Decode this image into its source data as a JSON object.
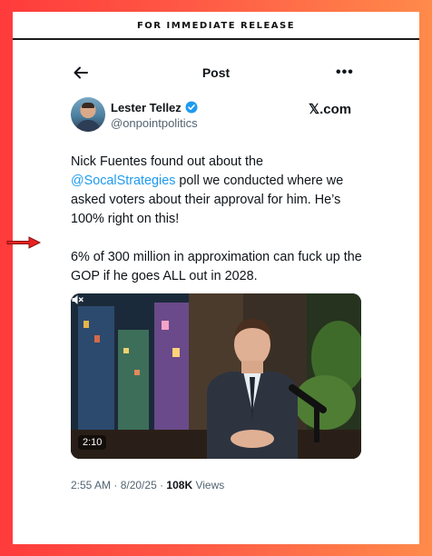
{
  "banner": {
    "text": "FOR IMMEDIATE RELEASE"
  },
  "header": {
    "title": "Post",
    "back_icon": "arrow-left-icon",
    "more_icon": "more-horizontal-icon"
  },
  "author": {
    "name": "Lester Tellez",
    "handle": "@onpointpolitics",
    "verified": true,
    "source": "𝕏.com"
  },
  "tweet": {
    "part1": "Nick Fuentes found out about the ",
    "mention": "@SocalStrategies",
    "part2": " poll we conducted where we asked voters about their approval for him. He’s 100% right on this!",
    "paragraph2": "6% of 300 million in approximation can fuck up the GOP if he goes ALL out in 2028."
  },
  "media": {
    "duration": "2:10",
    "mute_icon": "speaker-muted-icon"
  },
  "meta": {
    "time": "2:55 AM",
    "date": "8/20/25",
    "views_count": "108K",
    "views_label": " Views"
  },
  "colors": {
    "accent": "#1d9bf0",
    "arrow": "#e8231f",
    "text": "#0f1419",
    "muted": "#536471"
  }
}
